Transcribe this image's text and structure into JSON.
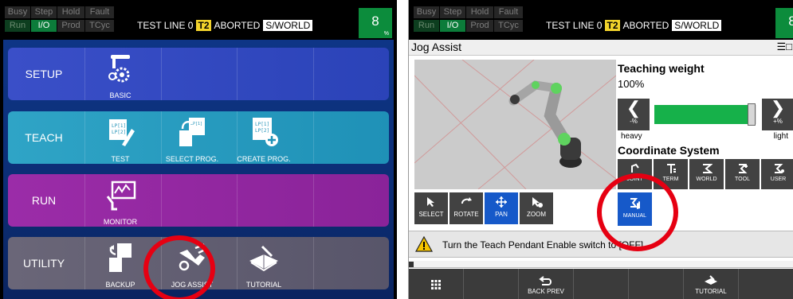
{
  "status": {
    "indicators": [
      {
        "label": "Busy",
        "state": "off"
      },
      {
        "label": "Step",
        "state": "off"
      },
      {
        "label": "Hold",
        "state": "off"
      },
      {
        "label": "Fault",
        "state": "off"
      },
      {
        "label": "Run",
        "state": "dim"
      },
      {
        "label": "I/O",
        "state": "on"
      },
      {
        "label": "Prod",
        "state": "off"
      },
      {
        "label": "TCyc",
        "state": "off"
      }
    ],
    "program": "TEST LINE 0",
    "mode": "T2",
    "state": "ABORTED",
    "frame": "S/WORLD",
    "override": "8",
    "override_unit": "%"
  },
  "main_menu": {
    "rows": [
      {
        "label": "SETUP",
        "items": [
          {
            "label": "BASIC"
          }
        ]
      },
      {
        "label": "TEACH",
        "items": [
          {
            "label": "TEST"
          },
          {
            "label": "SELECT PROG."
          },
          {
            "label": "CREATE PROG."
          }
        ]
      },
      {
        "label": "RUN",
        "items": [
          {
            "label": "MONITOR"
          }
        ]
      },
      {
        "label": "UTILITY",
        "items": [
          {
            "label": "BACKUP"
          },
          {
            "label": "JOG ASSIST"
          },
          {
            "label": "TUTORIAL"
          }
        ]
      }
    ]
  },
  "jog_assist": {
    "title": "Jog Assist",
    "view_buttons": [
      {
        "label": "SELECT"
      },
      {
        "label": "ROTATE"
      },
      {
        "label": "PAN"
      },
      {
        "label": "ZOOM"
      }
    ],
    "teaching_weight": {
      "title": "Teaching weight",
      "value": "100%",
      "level": 0.95,
      "minus_label": "-%",
      "plus_label": "+%",
      "heavy_label": "heavy",
      "light_label": "light"
    },
    "coordinate_system": {
      "title": "Coordinate System",
      "buttons": [
        {
          "label": "JOINT"
        },
        {
          "label": "TERM"
        },
        {
          "label": "WORLD"
        },
        {
          "label": "TOOL"
        },
        {
          "label": "USER"
        }
      ],
      "manual_label": "MANUAL"
    },
    "message": "Turn the Teach Pendant Enable switch to [OFF]",
    "function_keys": [
      {
        "label": ""
      },
      {
        "label": ""
      },
      {
        "label": "BACK PREV"
      },
      {
        "label": ""
      },
      {
        "label": ""
      },
      {
        "label": "TUTORIAL"
      },
      {
        "label": ""
      }
    ]
  },
  "colors": {
    "highlight_ring": "#e60012",
    "accent_green": "#16b14a",
    "active_blue": "#1659c9",
    "mode_yellow": "#f2d32b"
  }
}
